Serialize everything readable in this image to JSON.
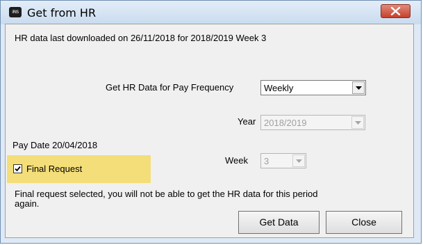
{
  "window": {
    "title": "Get from HR",
    "app_icon_text": "iRIS"
  },
  "main": {
    "last_download_text": "HR data last downloaded on 26/11/2018 for 2018/2019 Week 3",
    "pay_frequency_label": "Get HR Data for Pay Frequency",
    "pay_frequency_value": "Weekly",
    "year_label": "Year",
    "year_value": "2018/2019",
    "pay_date_text": "Pay Date 20/04/2018",
    "week_label": "Week",
    "week_value": "3",
    "final_request_label": "Final Request",
    "final_request_checked": true,
    "warning_line1": "Final request selected, you will not be able to get the HR data for this period",
    "warning_line2": "again."
  },
  "buttons": {
    "get_data": "Get Data",
    "close": "Close"
  },
  "icons": {
    "close": "close-icon",
    "dropdown": "chevron-down-icon",
    "check": "checkmark-icon"
  },
  "colors": {
    "highlight": "#f4de79",
    "close_button": "#c7402b"
  }
}
